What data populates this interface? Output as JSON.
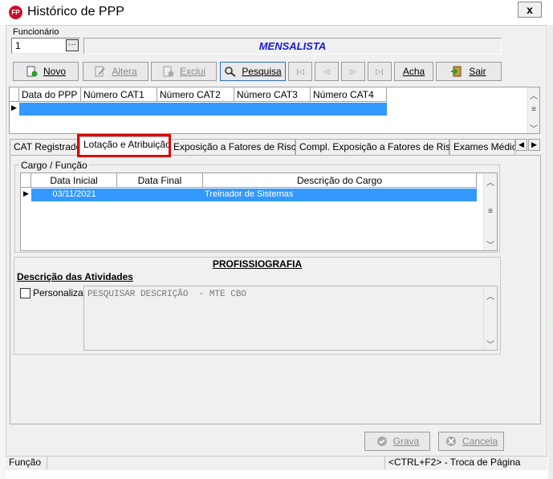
{
  "window": {
    "title": "Histórico de PPP",
    "icon_label": "FP",
    "close_label": "x"
  },
  "funcionario": {
    "label": "Funcionário",
    "value": "1",
    "browse_label": "···",
    "name": "MENSALISTA"
  },
  "toolbar": {
    "novo": "Novo",
    "altera": "Altera",
    "exclui": "Exclui",
    "pesquisa": "Pesquisa",
    "acha": "Acha",
    "sair": "Sair",
    "nav_first": "|◁",
    "nav_prev": "◁",
    "nav_next": "▷",
    "nav_last": "▷|"
  },
  "ppp_grid": {
    "columns": [
      "Data do PPP",
      "Número CAT1",
      "Número CAT2",
      "Número CAT3",
      "Número CAT4"
    ]
  },
  "tabs": {
    "items": [
      "CAT Registrado",
      "Lotação e Atribuição",
      "Exposição a Fatores de Riscos",
      "Compl. Exposição a Fatores de Riscos",
      "Exames Médico"
    ],
    "active_index": 1
  },
  "cargo": {
    "group_label": "Cargo / Função",
    "columns": [
      "Data Inicial",
      "Data Final",
      "Descrição do Cargo"
    ],
    "rows": [
      {
        "data_inicial": "03/11/2021",
        "data_final": "",
        "descricao": "Treinador de Sistemas"
      }
    ]
  },
  "profissiografia": {
    "title": "PROFISSIOGRAFIA",
    "subtitle": "Descrição das Atividades",
    "checkbox_label": "Personaliza",
    "text": "PESQUISAR DESCRIÇÃO  - MTE CBO"
  },
  "footer": {
    "grava": "Grava",
    "cancela": "Cancela",
    "status_field": "Função",
    "status_hint": "<CTRL+F2> - Troca de Página"
  },
  "colors": {
    "selection": "#3399ff",
    "mensalista_text": "#1a1ad6",
    "tab_highlight": "#e00000"
  }
}
